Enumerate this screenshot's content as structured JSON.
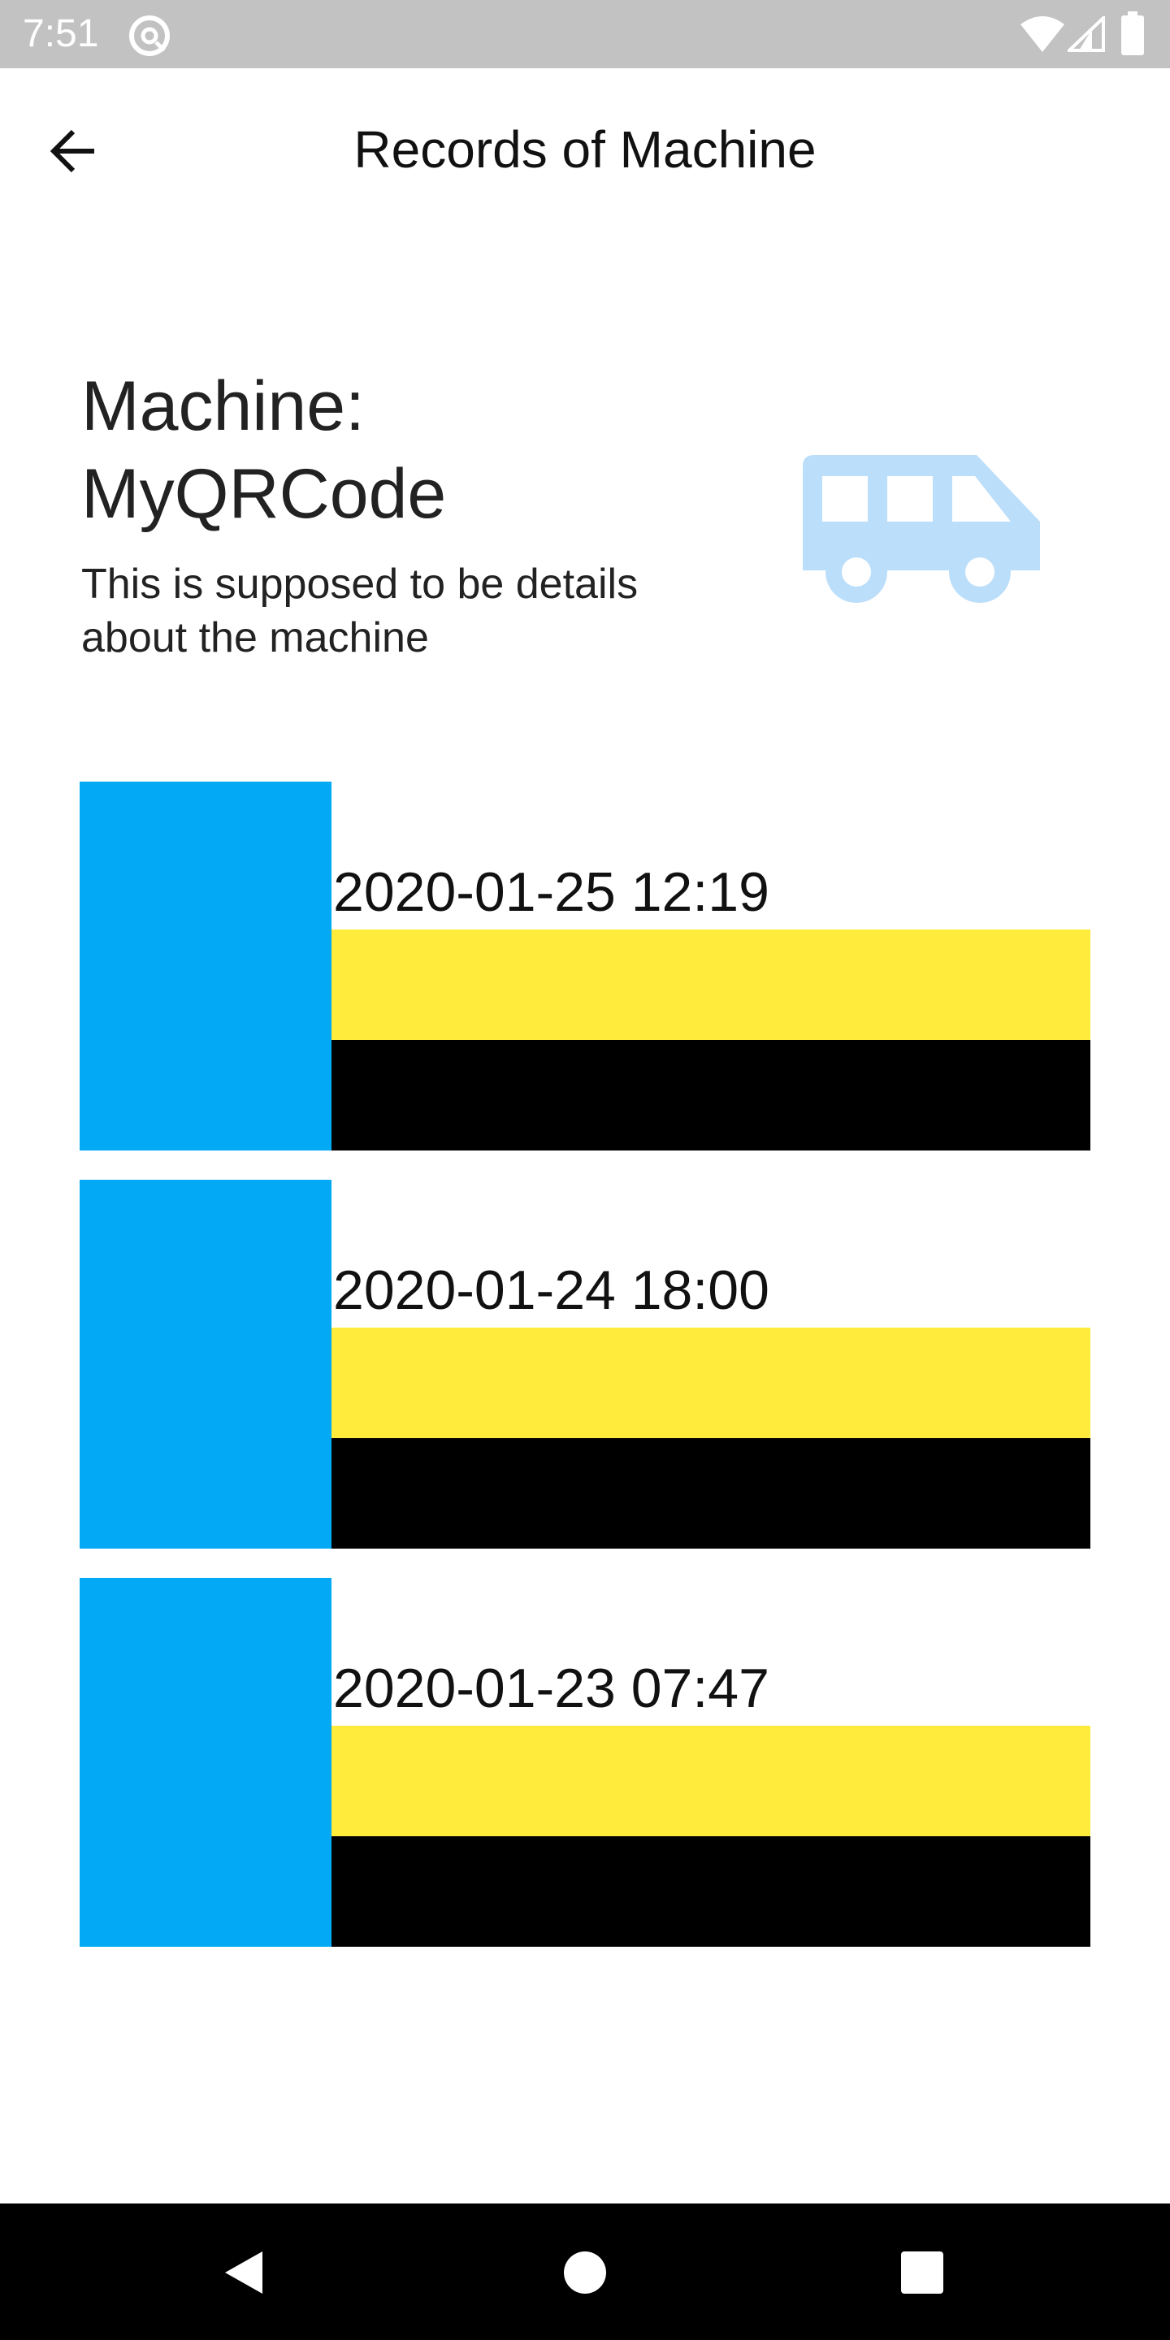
{
  "status_bar": {
    "time": "7:51",
    "icons": [
      "at-sign-icon",
      "wifi-icon",
      "cell-signal-icon",
      "battery-icon"
    ]
  },
  "app_bar": {
    "back_icon": "arrow-left-icon",
    "title": "Records of Machine"
  },
  "machine": {
    "name": "Machine: MyQRCode",
    "description": "This is supposed to be details about the machine",
    "icon": "bus-icon"
  },
  "records": [
    {
      "date": "2020-01-25 12:19"
    },
    {
      "date": "2020-01-24 18:00"
    },
    {
      "date": "2020-01-23 07:47"
    }
  ],
  "nav_bar": {
    "icons": [
      "back-triangle-icon",
      "home-circle-icon",
      "recents-square-icon"
    ]
  },
  "colors": {
    "status_bar": "#c2c2c2",
    "thumb_blue": "#03a9f4",
    "band_yellow": "#ffeb3b",
    "band_black": "#000000",
    "machine_icon": "#bbdefb",
    "nav_bar": "#000000"
  }
}
